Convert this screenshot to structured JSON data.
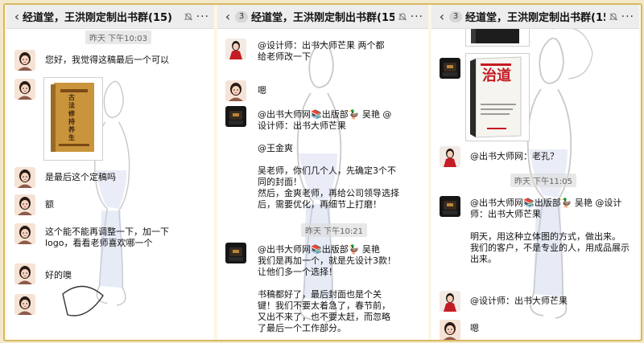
{
  "group_title": "经道堂，王洪刚定制出书群(15)",
  "unread_count": "3",
  "left": {
    "timestamp": "昨天 下午10:03",
    "messages": [
      {
        "text": "您好，我觉得这稿最后一个可以"
      },
      {
        "book_title": "古法修持养生"
      },
      {
        "text": "是最后这个定稿吗"
      },
      {
        "text": "额"
      },
      {
        "text": "这个能不能再调整一下，加一下logo，看看老师喜欢哪一个"
      },
      {
        "text": "好的噢"
      }
    ]
  },
  "middle": {
    "timestamp": "昨天 下午10:21",
    "messages": [
      {
        "text": "@设计师：出书大师芒果 两个都给老师改一下"
      },
      {
        "text": "嗯"
      },
      {
        "text": "@出书大师网📚出版部🦆 吴艳 @设计师：出书大师芒果\n\n@王金爽\n\n吴老师，你们几个人，先确定3个不同的封面！\n然后，金爽老师，再给公司领导选择后，需要优化，再细节上打磨！"
      },
      {
        "text": "@出书大师网📚出版部🦆 吴艳\n我们是再加一个，就是先设计3款！让他们多一个选择！\n\n书稿都好了，最后封面也是个关键！我们不要太着急了，春节前，又出不来了，也不要太赶，而忽略了最后一个工作部分。"
      }
    ]
  },
  "right": {
    "timestamp": "昨天 下午11:05",
    "messages": [
      {
        "book_title": "治道"
      },
      {
        "text": "@出书大师网：老孔？"
      },
      {
        "text": "@出书大师网📚出版部🦆 吴艳 @设计师：出书大师芒果\n\n明天，用这种立体图的方式，做出来。\n我们的客户，不是专业的人，用成品展示出来。"
      },
      {
        "text": "@设计师：出书大师芒果"
      },
      {
        "text": "嗯"
      }
    ]
  },
  "colors": {
    "accent_border": "#d9b863",
    "header_bg": "#ededed"
  }
}
